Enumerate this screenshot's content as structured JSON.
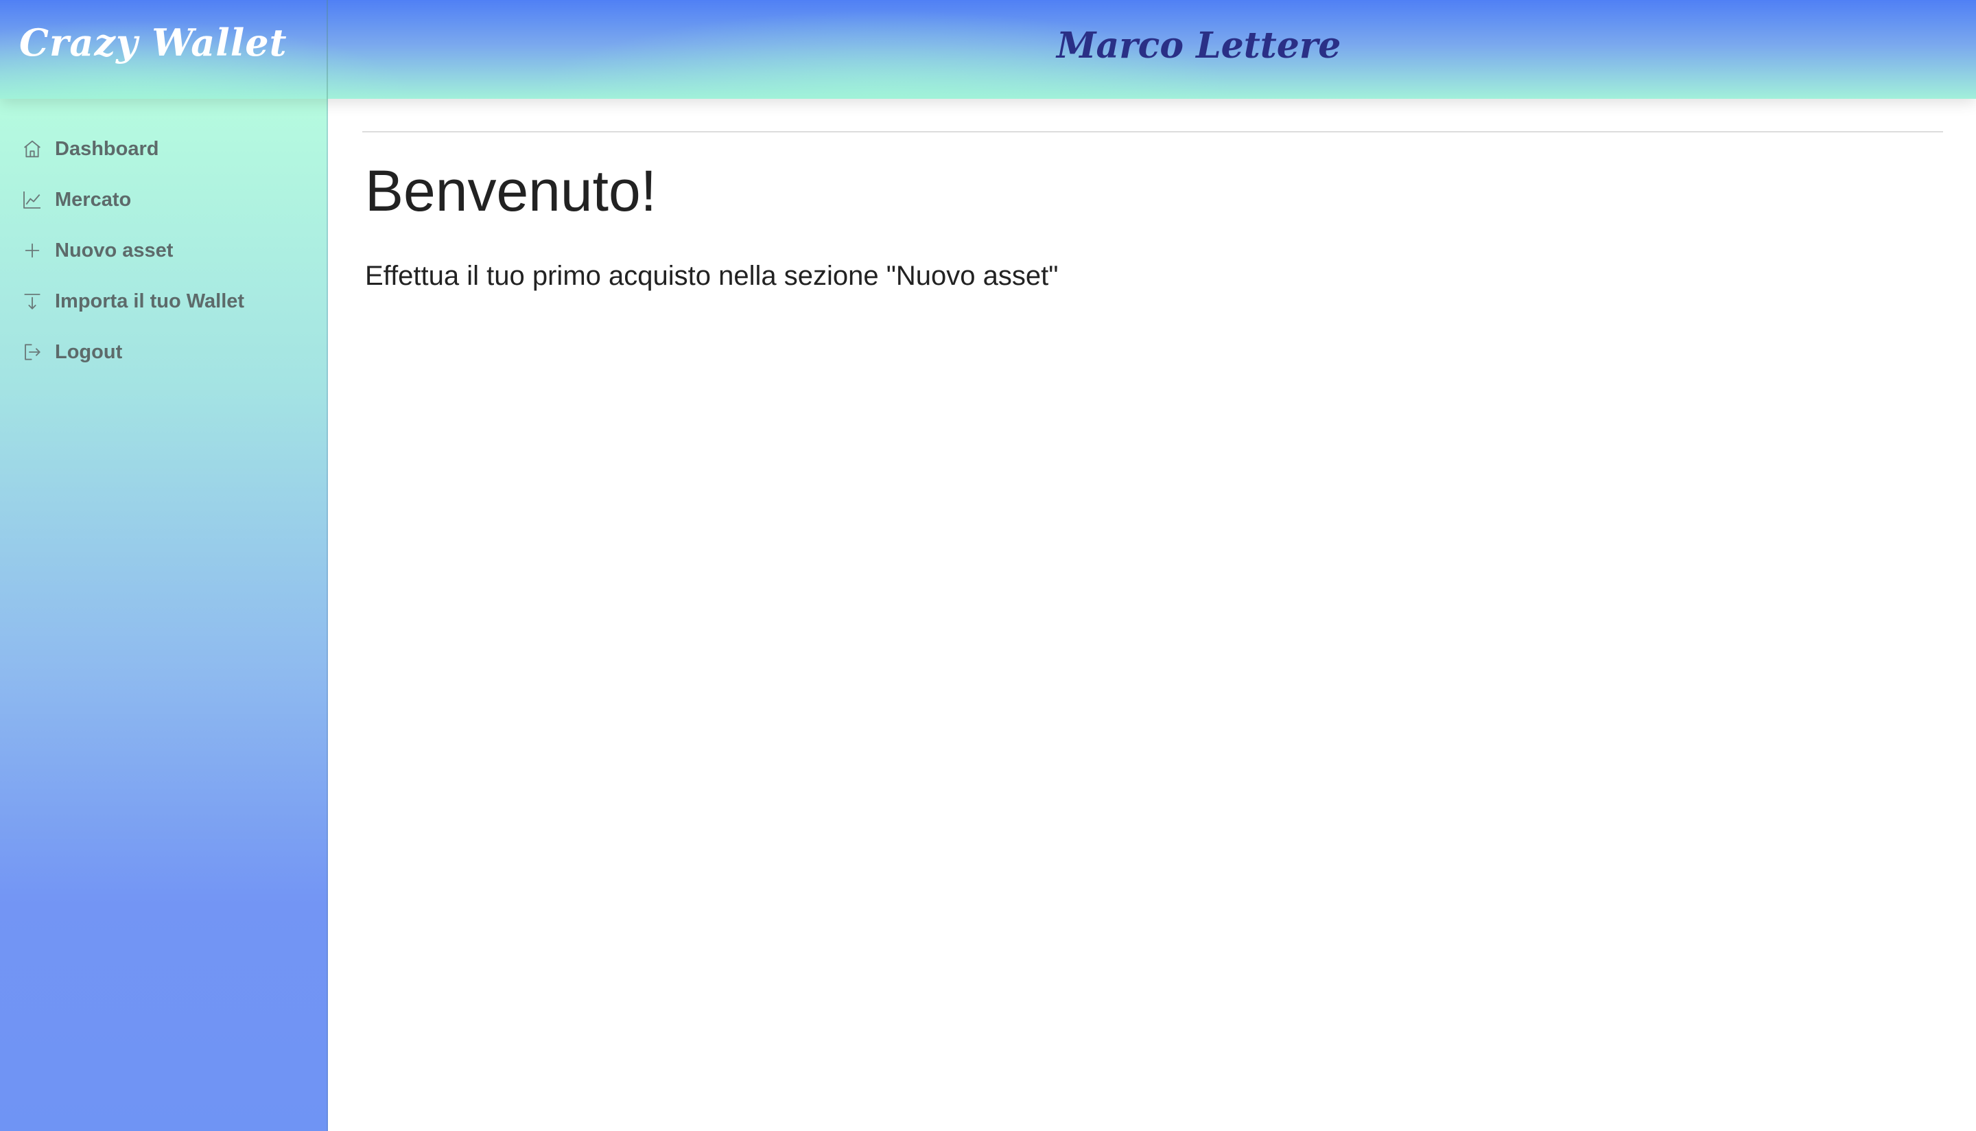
{
  "header": {
    "brand": "Crazy Wallet",
    "user_name": "Marco Lettere"
  },
  "sidebar": {
    "items": [
      {
        "label": "Dashboard",
        "icon": "home-icon"
      },
      {
        "label": "Mercato",
        "icon": "line-chart-icon"
      },
      {
        "label": "Nuovo asset",
        "icon": "plus-icon"
      },
      {
        "label": "Importa il tuo Wallet",
        "icon": "import-icon"
      },
      {
        "label": "Logout",
        "icon": "logout-icon"
      }
    ]
  },
  "main": {
    "heading": "Benvenuto!",
    "message": "Effettua il tuo primo acquisto nella sezione \"Nuovo asset\""
  },
  "colors": {
    "header_gradient_top": "#5080f5",
    "header_gradient_bottom": "#a2f0da",
    "sidebar_gradient_top": "#b6fbdf",
    "sidebar_gradient_bottom": "#6f94f4",
    "user_name": "#2a2f86",
    "nav_text": "#5d6a6a"
  }
}
